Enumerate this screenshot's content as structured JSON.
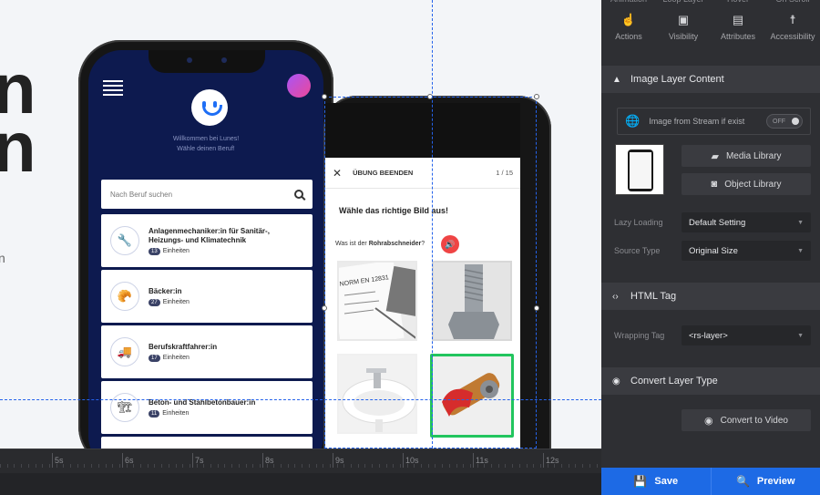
{
  "canvas": {
    "hero_line_1": "n",
    "hero_line_2": "n",
    "hero_sub": "n",
    "phone1": {
      "welcome_line_1": "Willkommen bei Lunes!",
      "welcome_line_2": "Wähle deinen Beruf!",
      "search_placeholder": "Nach Beruf suchen",
      "jobs": [
        {
          "title": "Anlagenmechaniker:in für Sanitär-, Heizungs- und Klimatechnik",
          "count": "13",
          "units": "Einheiten",
          "icon": "🔧"
        },
        {
          "title": "Bäcker:in",
          "count": "27",
          "units": "Einheiten",
          "icon": "🥐"
        },
        {
          "title": "Berufskraftfahrer:in",
          "count": "17",
          "units": "Einheiten",
          "icon": "🚚"
        },
        {
          "title": "Beton- und Stahlbetonbauer:in",
          "count": "11",
          "units": "Einheiten",
          "icon": "🏗"
        }
      ]
    },
    "phone2": {
      "close": "✕",
      "end_exercise": "ÜBUNG BEENDEN",
      "pager": "1 / 15",
      "question": "Wähle das richtige Bild aus!",
      "sub_prefix": "Was ist der ",
      "sub_bold": "Rohrabschneider",
      "sub_suffix": "?",
      "calc_text": "NORM EN 12831"
    }
  },
  "timeline": {
    "labels": [
      "5s",
      "6s",
      "7s",
      "8s",
      "9s",
      "10s",
      "11s",
      "12s"
    ]
  },
  "panel": {
    "top_tabs": [
      "Animation",
      "Loop Layer",
      "Hover",
      "On Scroll"
    ],
    "icon_tabs": [
      {
        "label": "Actions",
        "icon": "hand-pointer-icon"
      },
      {
        "label": "Visibility",
        "icon": "visibility-icon"
      },
      {
        "label": "Attributes",
        "icon": "file-icon"
      },
      {
        "label": "Accessibility",
        "icon": "accessibility-icon"
      }
    ],
    "image_section": "Image Layer Content",
    "stream_label": "Image from Stream if exist",
    "stream_toggle": "OFF",
    "media_library": "Media Library",
    "object_library": "Object Library",
    "lazy_label": "Lazy Loading",
    "lazy_value": "Default Setting",
    "source_label": "Source Type",
    "source_value": "Original Size",
    "html_section": "HTML Tag",
    "wrap_label": "Wrapping Tag",
    "wrap_value": "<rs-layer>",
    "convert_section": "Convert Layer Type",
    "convert_btn": "Convert to Video",
    "save": "Save",
    "preview": "Preview",
    "accent": "#1d6ae5"
  }
}
